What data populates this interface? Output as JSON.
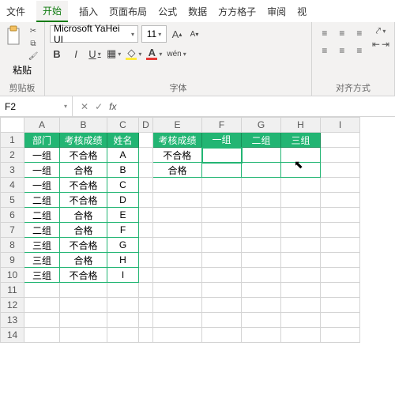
{
  "tabs": {
    "file": "文件",
    "home": "开始",
    "insert": "插入",
    "layout": "页面布局",
    "formula": "公式",
    "data": "数据",
    "square": "方方格子",
    "review": "审阅",
    "vis": "视"
  },
  "clip": {
    "paste": "粘贴",
    "group": "剪贴板"
  },
  "font": {
    "name": "Microsoft YaHei UI",
    "size": "11",
    "bold": "B",
    "italic": "I",
    "underline": "U",
    "wen": "wén",
    "group": "字体",
    "grow": "A",
    "shrink": "A"
  },
  "align": {
    "group": "对齐方式"
  },
  "namebox": {
    "ref": "F2",
    "cancel": "✕",
    "enter": "✓",
    "fx": "fx"
  },
  "cols": [
    "A",
    "B",
    "C",
    "D",
    "E",
    "F",
    "G",
    "H",
    "I"
  ],
  "rows": [
    "1",
    "2",
    "3",
    "4",
    "5",
    "6",
    "7",
    "8",
    "9",
    "10",
    "11",
    "12",
    "13",
    "14"
  ],
  "hdr_left": {
    "dept": "部门",
    "score": "考核成绩",
    "name": "姓名"
  },
  "hdr_right": {
    "score": "考核成绩",
    "g1": "一组",
    "g2": "二组",
    "g3": "三组"
  },
  "data_left": [
    {
      "d": "一组",
      "s": "不合格",
      "n": "A"
    },
    {
      "d": "一组",
      "s": "合格",
      "n": "B"
    },
    {
      "d": "一组",
      "s": "不合格",
      "n": "C"
    },
    {
      "d": "二组",
      "s": "不合格",
      "n": "D"
    },
    {
      "d": "二组",
      "s": "合格",
      "n": "E"
    },
    {
      "d": "二组",
      "s": "合格",
      "n": "F"
    },
    {
      "d": "三组",
      "s": "不合格",
      "n": "G"
    },
    {
      "d": "三组",
      "s": "合格",
      "n": "H"
    },
    {
      "d": "三组",
      "s": "不合格",
      "n": "I"
    }
  ],
  "data_right": {
    "r2": "不合格",
    "r3": "合格"
  },
  "chart_data": {
    "type": "table",
    "source": {
      "columns": [
        "部门",
        "考核成绩",
        "姓名"
      ],
      "rows": [
        [
          "一组",
          "不合格",
          "A"
        ],
        [
          "一组",
          "合格",
          "B"
        ],
        [
          "一组",
          "不合格",
          "C"
        ],
        [
          "二组",
          "不合格",
          "D"
        ],
        [
          "二组",
          "合格",
          "E"
        ],
        [
          "二组",
          "合格",
          "F"
        ],
        [
          "三组",
          "不合格",
          "G"
        ],
        [
          "三组",
          "合格",
          "H"
        ],
        [
          "三组",
          "不合格",
          "I"
        ]
      ]
    },
    "pivot": {
      "row": "考核成绩",
      "columns": [
        "一组",
        "二组",
        "三组"
      ],
      "row_values": [
        "不合格",
        "合格"
      ]
    }
  },
  "colors": {
    "accent": "#22b573"
  }
}
